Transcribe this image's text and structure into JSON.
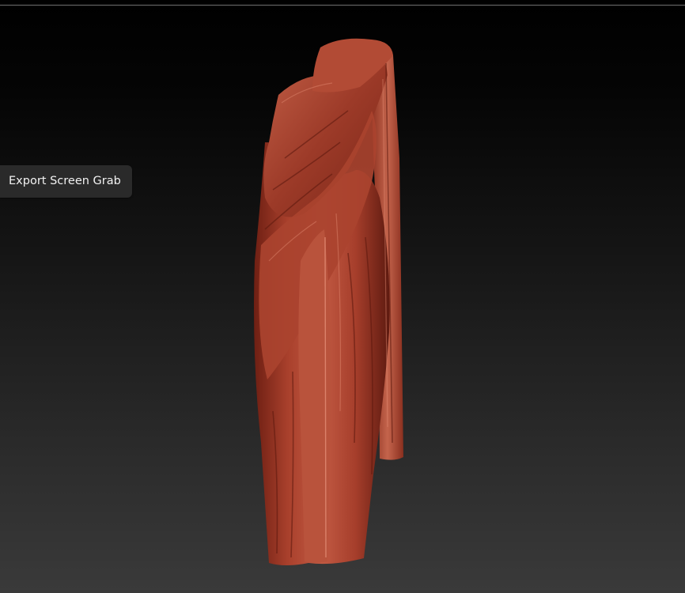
{
  "tooltip": {
    "label": "Export Screen Grab"
  },
  "viewport": {
    "background_top": "#000000",
    "background_bottom": "#3a3a3a"
  },
  "model": {
    "material_color": "#b5432f"
  }
}
